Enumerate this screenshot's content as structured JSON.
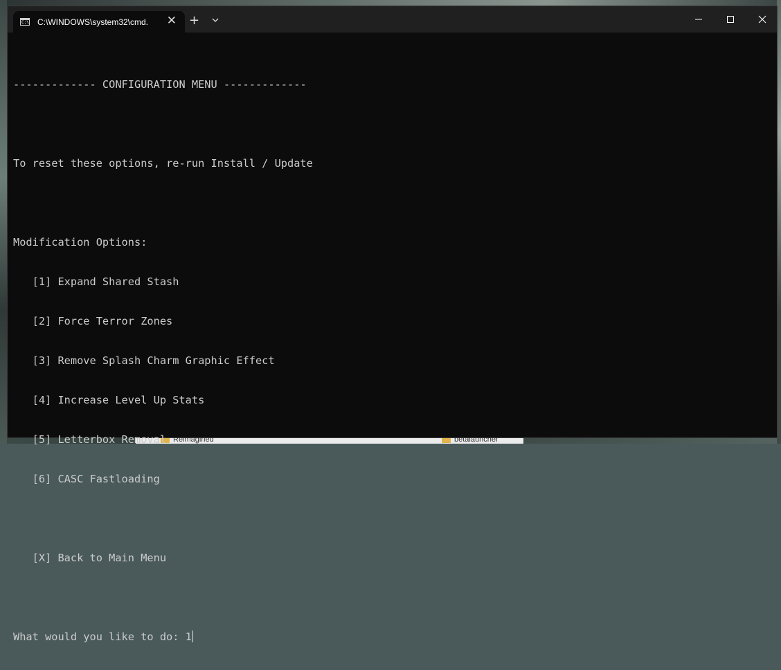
{
  "window": {
    "tab_title": "C:\\WINDOWS\\system32\\cmd.",
    "new_tab_symbol": "+",
    "close_tab_symbol": "✕"
  },
  "console": {
    "lines": [
      "------------- CONFIGURATION MENU -------------",
      "",
      "To reset these options, re-run Install / Update",
      "",
      "Modification Options:",
      "   [1] Expand Shared Stash",
      "   [2] Force Terror Zones",
      "   [3] Remove Splash Charm Graphic Effect",
      "   [4] Increase Level Up Stats",
      "   [5] Letterbox Removal",
      "   [6] CASC Fastloading",
      "",
      "   [X] Back to Main Menu",
      ""
    ],
    "prompt": "What would you like to do: ",
    "input_value": "1"
  },
  "background": {
    "explorer_folders": [
      "Reimagined",
      "betalauncher"
    ]
  },
  "icons": {
    "tab_icon": "cmd-icon",
    "minimize": "minimize-icon",
    "maximize": "maximize-icon",
    "close": "close-icon",
    "dropdown": "chevron-down-icon"
  },
  "colors": {
    "console_bg": "#0c0c0c",
    "console_fg": "#cccccc",
    "titlebar_bg": "#202020"
  }
}
